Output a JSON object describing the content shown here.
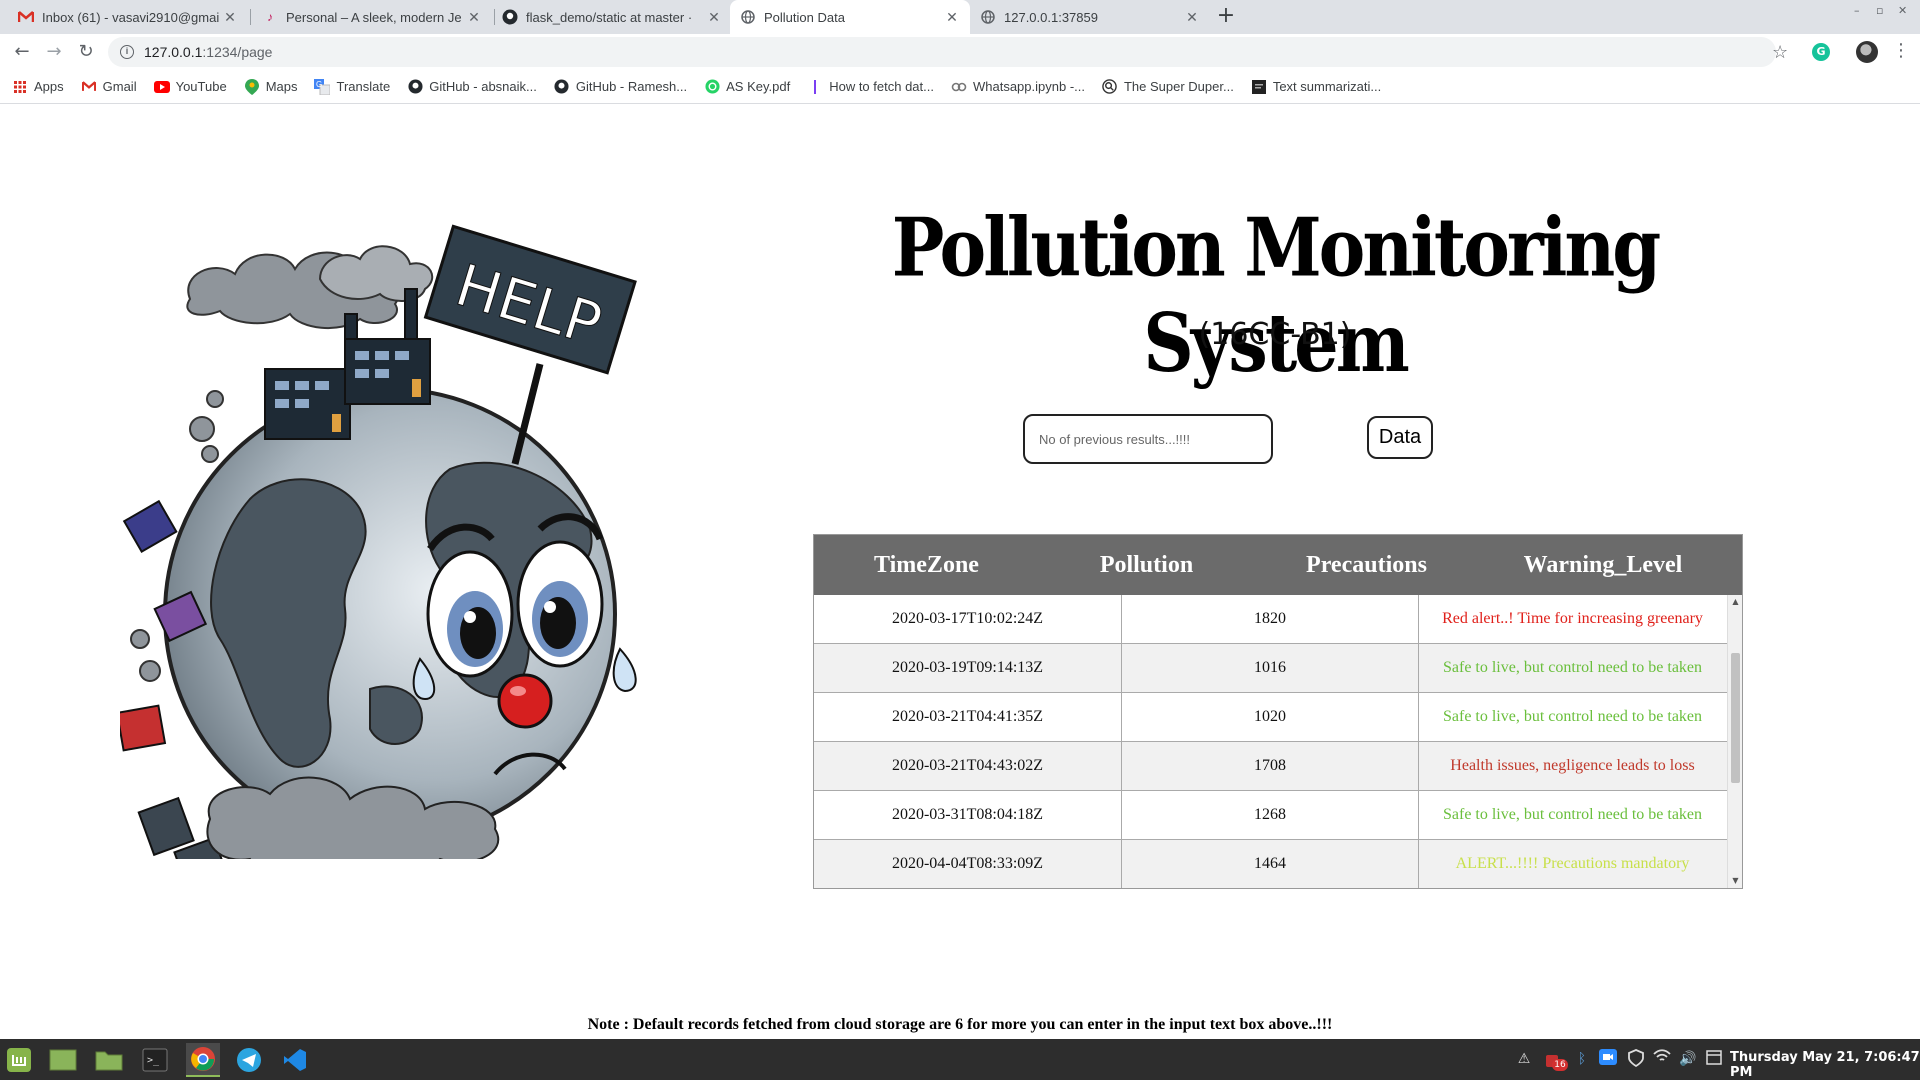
{
  "browser": {
    "tabs": [
      {
        "title": "Inbox (61) - vasavi2910@gmai",
        "icon": "gmail-icon"
      },
      {
        "title": "Personal – A sleek, modern Je",
        "icon": "jekyll-icon"
      },
      {
        "title": "flask_demo/static at master ·",
        "icon": "github-icon"
      },
      {
        "title": "Pollution Data",
        "icon": "globe-icon"
      },
      {
        "title": "127.0.0.1:37859",
        "icon": "globe-icon"
      }
    ],
    "url_host": "127.0.0.1",
    "url_path": ":1234/page",
    "bookmarks": [
      {
        "label": "Apps",
        "icon": "apps-grid-icon"
      },
      {
        "label": "Gmail",
        "icon": "gmail-icon"
      },
      {
        "label": "YouTube",
        "icon": "youtube-icon"
      },
      {
        "label": "Maps",
        "icon": "maps-icon"
      },
      {
        "label": "Translate",
        "icon": "translate-icon"
      },
      {
        "label": "GitHub - absnaik...",
        "icon": "github-icon"
      },
      {
        "label": "GitHub - Ramesh...",
        "icon": "github-icon"
      },
      {
        "label": "AS Key.pdf",
        "icon": "whatsapp-icon"
      },
      {
        "label": "How to fetch dat...",
        "icon": "bookmark-icon"
      },
      {
        "label": "Whatsapp.ipynb -...",
        "icon": "colab-icon"
      },
      {
        "label": "The Super Duper...",
        "icon": "search-icon"
      },
      {
        "label": "Text summarizati...",
        "icon": "doc-icon"
      }
    ]
  },
  "page": {
    "title": "Pollution Monitoring System",
    "subtitle": "(16CC-B1)",
    "input_placeholder": "No of previous results...!!!!",
    "button_label": "Data",
    "table": {
      "headers": [
        "TimeZone",
        "Pollution",
        "Precautions",
        "Warning_Level"
      ],
      "rows": [
        {
          "time": "2020-03-17T10:02:24Z",
          "value": "1820",
          "warning": "Red alert..! Time for increasing greenary",
          "color": "#e0201a"
        },
        {
          "time": "2020-03-19T09:14:13Z",
          "value": "1016",
          "warning": "Safe to live, but control need to be taken",
          "color": "#6abf3c"
        },
        {
          "time": "2020-03-21T04:41:35Z",
          "value": "1020",
          "warning": "Safe to live, but control need to be taken",
          "color": "#6abf3c"
        },
        {
          "time": "2020-03-21T04:43:02Z",
          "value": "1708",
          "warning": "Health issues, negligence leads to loss",
          "color": "#c0392b"
        },
        {
          "time": "2020-03-31T08:04:18Z",
          "value": "1268",
          "warning": "Safe to live, but control need to be taken",
          "color": "#6abf3c"
        },
        {
          "time": "2020-04-04T08:33:09Z",
          "value": "1464",
          "warning": "ALERT...!!!! Precautions mandatory",
          "color": "#c8e04a"
        }
      ]
    },
    "note": "Note : Default records fetched from cloud storage are 6 for more you can enter in the input text box above..!!!"
  },
  "taskbar": {
    "clock": "Thursday May 21, 7:06:47 PM",
    "badge_count": "16"
  }
}
